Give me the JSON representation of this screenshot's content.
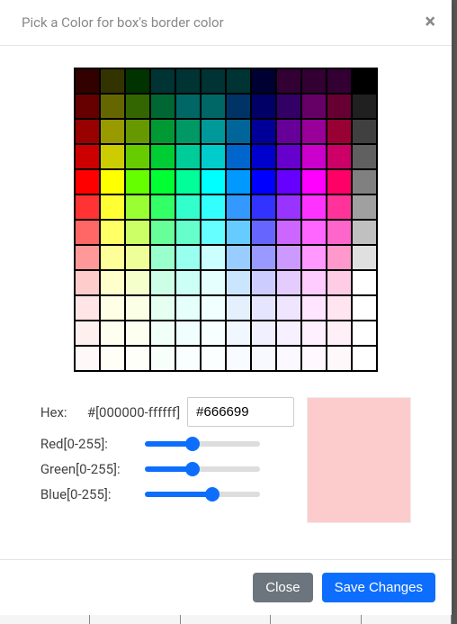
{
  "header": {
    "title": "Pick a Color for box's border color"
  },
  "hex": {
    "label": "Hex:",
    "prefix": "#[000000-ffffff]",
    "value": "#666699"
  },
  "red": {
    "label": "Red[0-255]:",
    "value": 102
  },
  "green": {
    "label": "Green[0-255]:",
    "value": 102
  },
  "blue": {
    "label": "Blue[0-255]:",
    "value": 153
  },
  "preview_color": "#fccccc",
  "buttons": {
    "close": "Close",
    "save": "Save Changes"
  },
  "swatch_colors": [
    "#330000",
    "#333300",
    "#003300",
    "#003333",
    "#003333",
    "#003333",
    "#003333",
    "#000033",
    "#330033",
    "#330033",
    "#330033",
    "#000000",
    "#660000",
    "#666600",
    "#336600",
    "#006633",
    "#006666",
    "#006666",
    "#003366",
    "#000066",
    "#330066",
    "#660066",
    "#660033",
    "#202020",
    "#990000",
    "#999900",
    "#669900",
    "#009933",
    "#009966",
    "#009999",
    "#006699",
    "#000099",
    "#660099",
    "#990099",
    "#990033",
    "#404040",
    "#cc0000",
    "#cccc00",
    "#66cc00",
    "#00cc33",
    "#00cc99",
    "#00cccc",
    "#0066cc",
    "#0000cc",
    "#6600cc",
    "#cc00cc",
    "#cc0066",
    "#606060",
    "#ff0000",
    "#ffff00",
    "#66ff00",
    "#00ff33",
    "#00ff99",
    "#00ffff",
    "#0099ff",
    "#0000ff",
    "#6600ff",
    "#ff00ff",
    "#ff0066",
    "#808080",
    "#ff3333",
    "#ffff33",
    "#99ff33",
    "#33ff66",
    "#33ffcc",
    "#33ffff",
    "#3399ff",
    "#3333ff",
    "#9933ff",
    "#ff33ff",
    "#ff3399",
    "#a0a0a0",
    "#ff6666",
    "#ffff66",
    "#ccff66",
    "#66ff99",
    "#66ffcc",
    "#66ffff",
    "#66ccff",
    "#6666ff",
    "#cc66ff",
    "#ff66ff",
    "#ff66cc",
    "#c0c0c0",
    "#ff9999",
    "#ffff99",
    "#eeff99",
    "#99ffcc",
    "#99ffee",
    "#ccffff",
    "#99ccff",
    "#9999ff",
    "#cc99ff",
    "#ff99ff",
    "#ff99cc",
    "#e0e0e0",
    "#ffcccc",
    "#ffffcc",
    "#f5ffcc",
    "#ccffe5",
    "#ccfff5",
    "#e5ffff",
    "#cce5ff",
    "#ccccff",
    "#e5ccff",
    "#ffccff",
    "#ffcce5",
    "#ffffff",
    "#ffe5e5",
    "#ffffe5",
    "#faffe5",
    "#e5fff0",
    "#e5fffa",
    "#f0ffff",
    "#e5f0ff",
    "#e5e5ff",
    "#f0e5ff",
    "#ffe5ff",
    "#ffe5f0",
    "#ffffff",
    "#fff0f0",
    "#fffff0",
    "#fdfff0",
    "#f0fff7",
    "#f0fffd",
    "#f7ffff",
    "#f0f7ff",
    "#f0f0ff",
    "#f7f0ff",
    "#fff0ff",
    "#fff0f7",
    "#ffffff",
    "#fff8f8",
    "#fffff8",
    "#fefff8",
    "#f8fffb",
    "#f8fffe",
    "#fbffff",
    "#f8fbff",
    "#f8f8ff",
    "#fbf8ff",
    "#fff8ff",
    "#fff8fb",
    "#ffffff"
  ]
}
